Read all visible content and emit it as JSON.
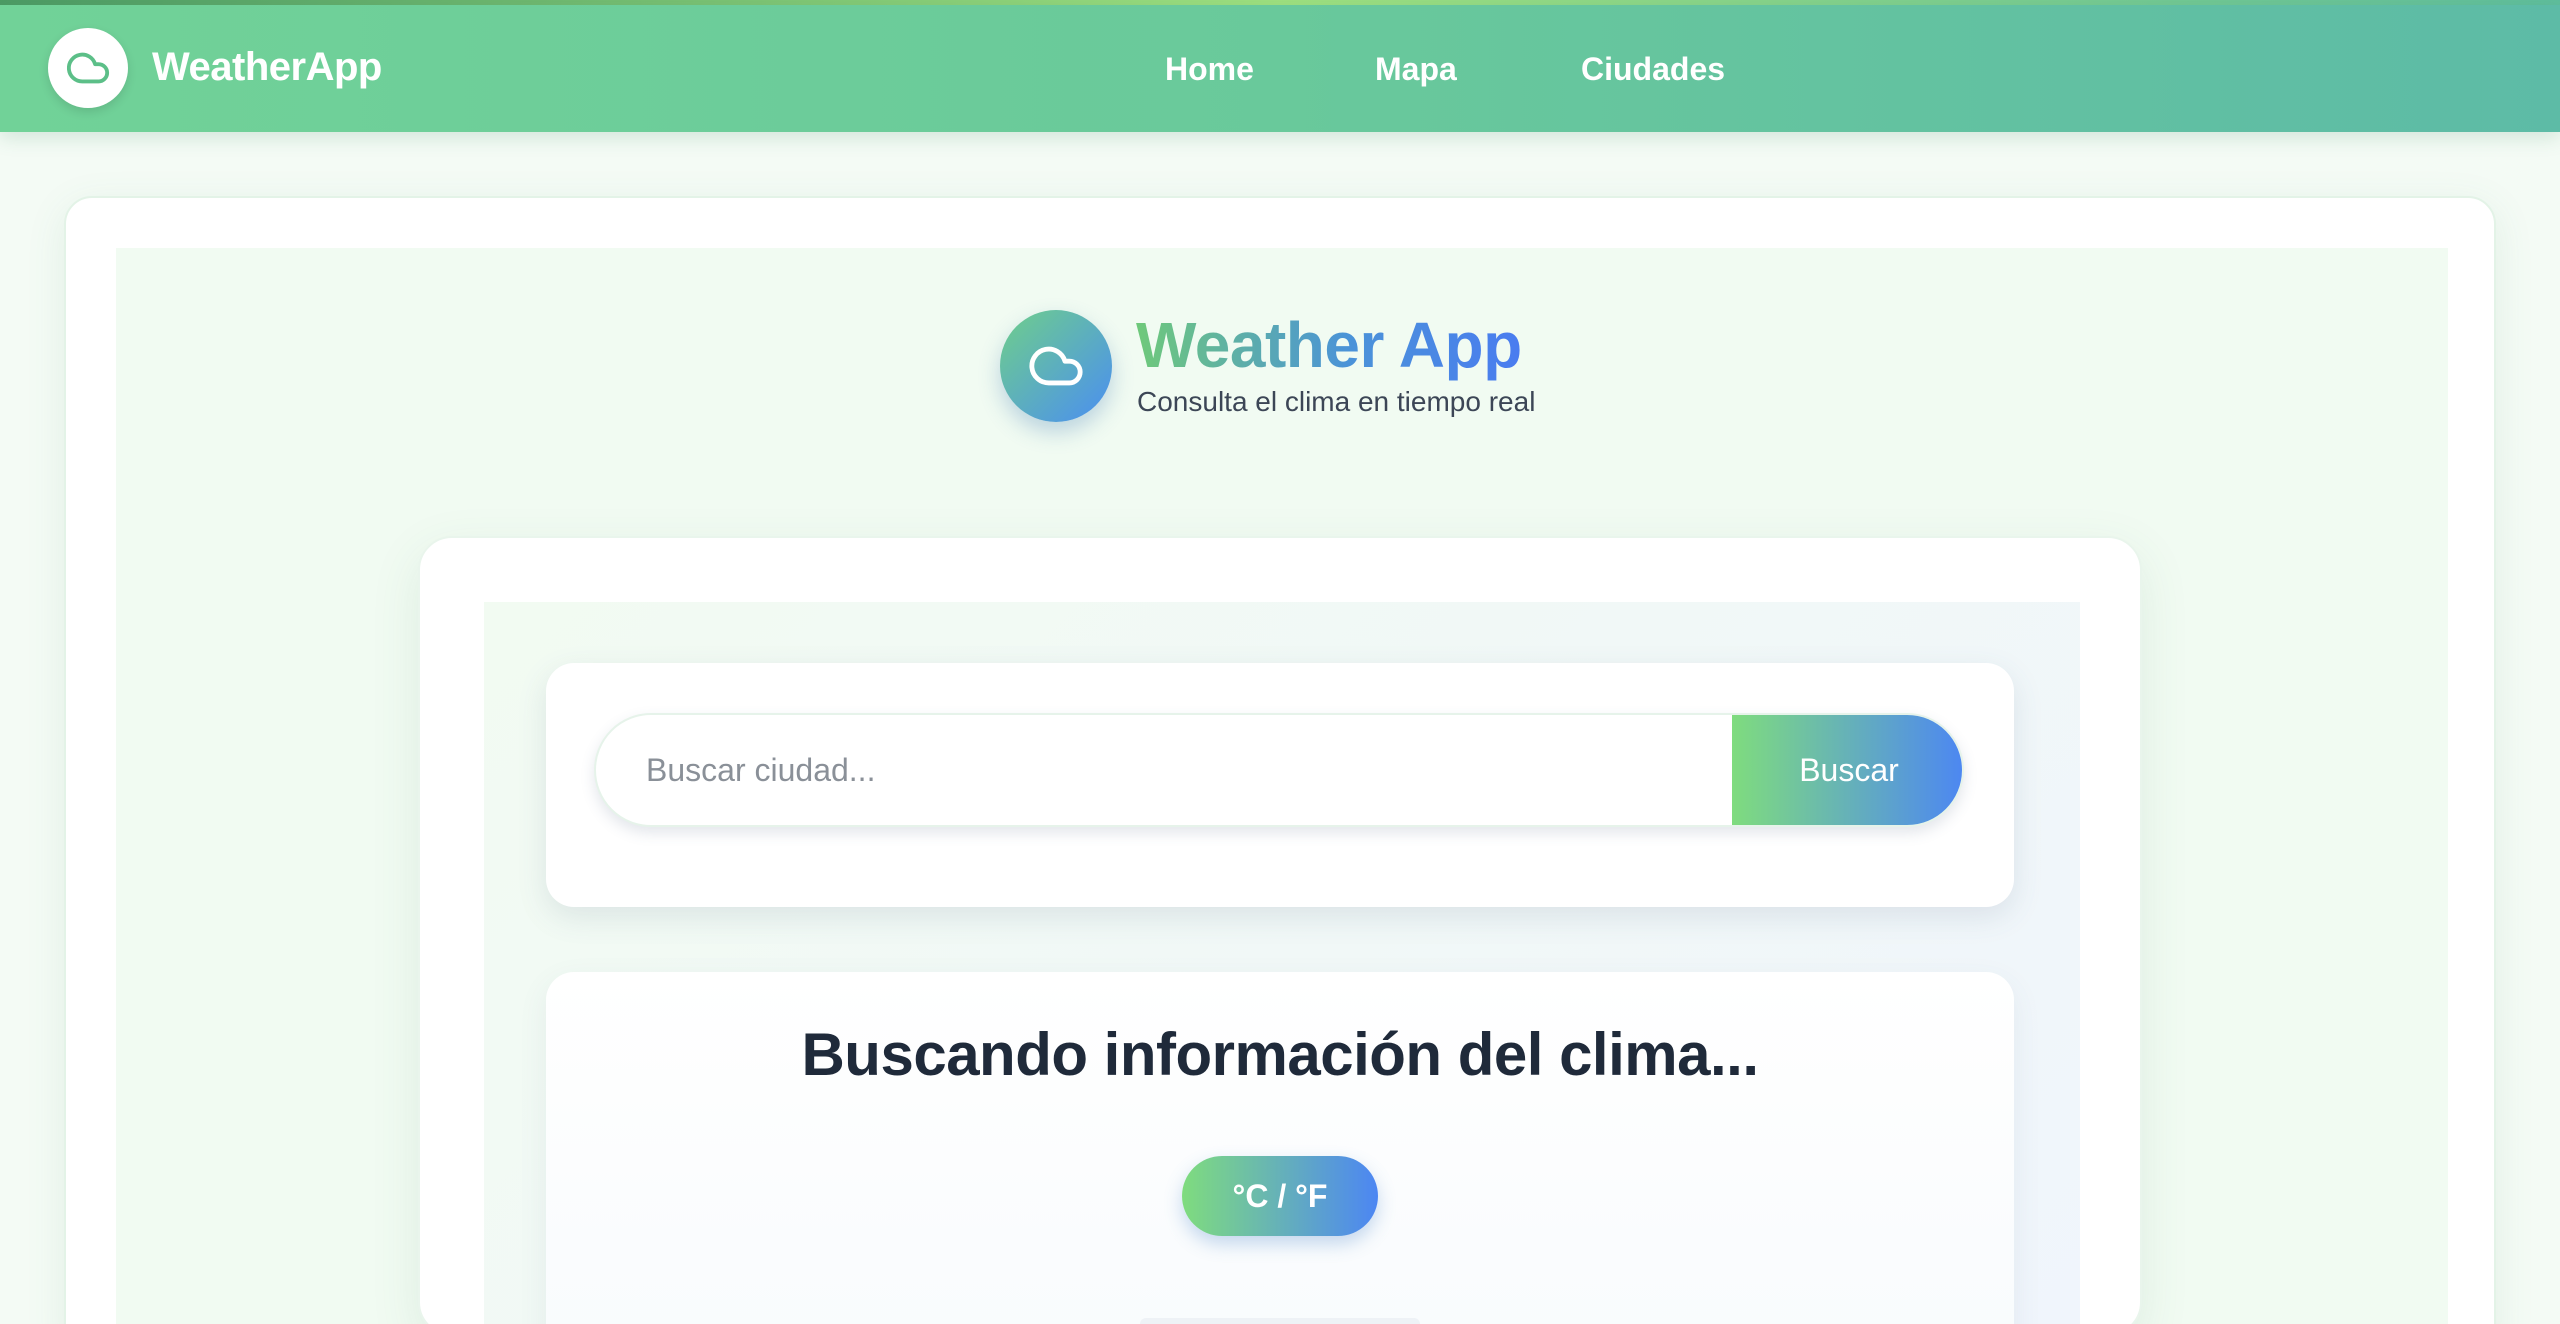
{
  "navbar": {
    "brand": "WeatherApp",
    "links": [
      {
        "label": "Home"
      },
      {
        "label": "Mapa"
      },
      {
        "label": "Ciudades"
      }
    ],
    "logo_icon": "cloud-icon"
  },
  "hero": {
    "title": "Weather App",
    "subtitle": "Consulta el clima en tiempo real",
    "icon": "cloud-icon"
  },
  "search": {
    "placeholder": "Buscar ciudad...",
    "value": "",
    "button_label": "Buscar"
  },
  "result": {
    "status_title": "Buscando información del clima...",
    "unit_toggle_label": "°C / °F"
  },
  "colors": {
    "navbar_start": "#71d298",
    "navbar_end": "#5dbba6",
    "gradient_green": "#7fdc7e",
    "gradient_blue": "#4c86f3",
    "text_dark": "#1f2a3a"
  }
}
